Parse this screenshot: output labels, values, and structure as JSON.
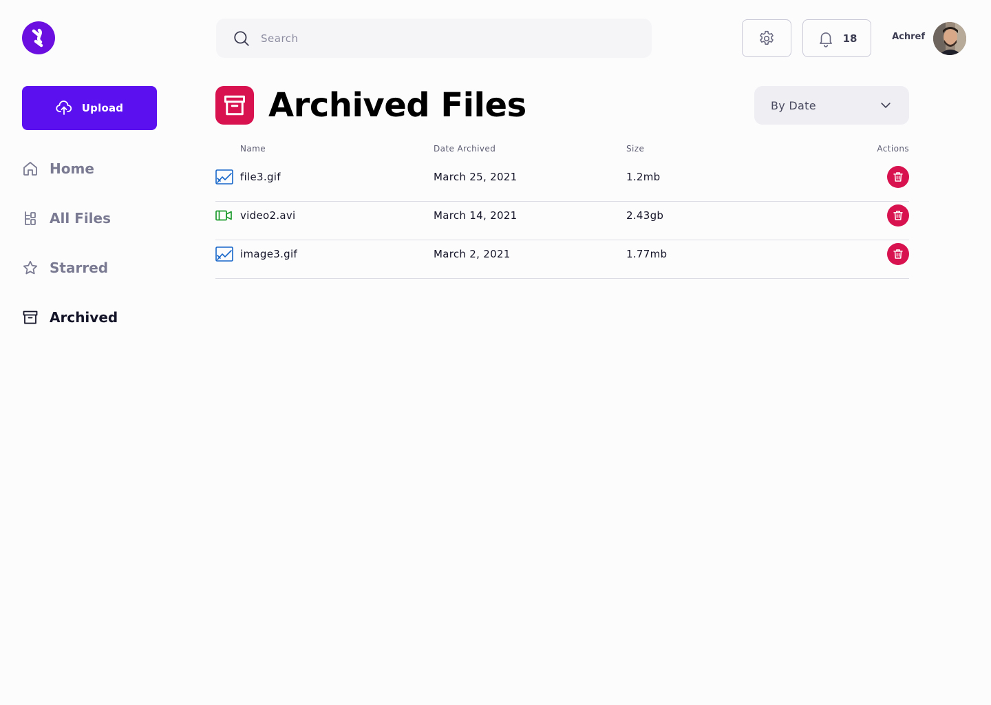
{
  "app": {
    "logo_icon": "app-logo-icon",
    "brand_color": "#5b10f0"
  },
  "sidebar": {
    "upload_label": "Upload",
    "items": [
      {
        "label": "Home",
        "icon": "home-icon",
        "active": false
      },
      {
        "label": "All Files",
        "icon": "files-icon",
        "active": false
      },
      {
        "label": "Starred",
        "icon": "star-icon",
        "active": false
      },
      {
        "label": "Archived",
        "icon": "archive-icon",
        "active": true
      }
    ]
  },
  "header": {
    "search_placeholder": "Search",
    "notification_count": "18",
    "user_name": "Achref"
  },
  "main": {
    "title": "Archived Files",
    "title_color": "#d8114f",
    "sort_selected": "By Date",
    "columns": [
      "Name",
      "Date Archived",
      "Size",
      "Actions"
    ],
    "rows": [
      {
        "name": "file3.gif",
        "type": "image",
        "icon": "image-file-icon",
        "date": "March 25, 2021",
        "size": "1.2mb"
      },
      {
        "name": "video2.avi",
        "type": "video",
        "icon": "video-file-icon",
        "date": "March 14, 2021",
        "size": "2.43gb"
      },
      {
        "name": "image3.gif",
        "type": "image",
        "icon": "image-file-icon",
        "date": "March 2, 2021",
        "size": "1.77mb"
      }
    ]
  }
}
